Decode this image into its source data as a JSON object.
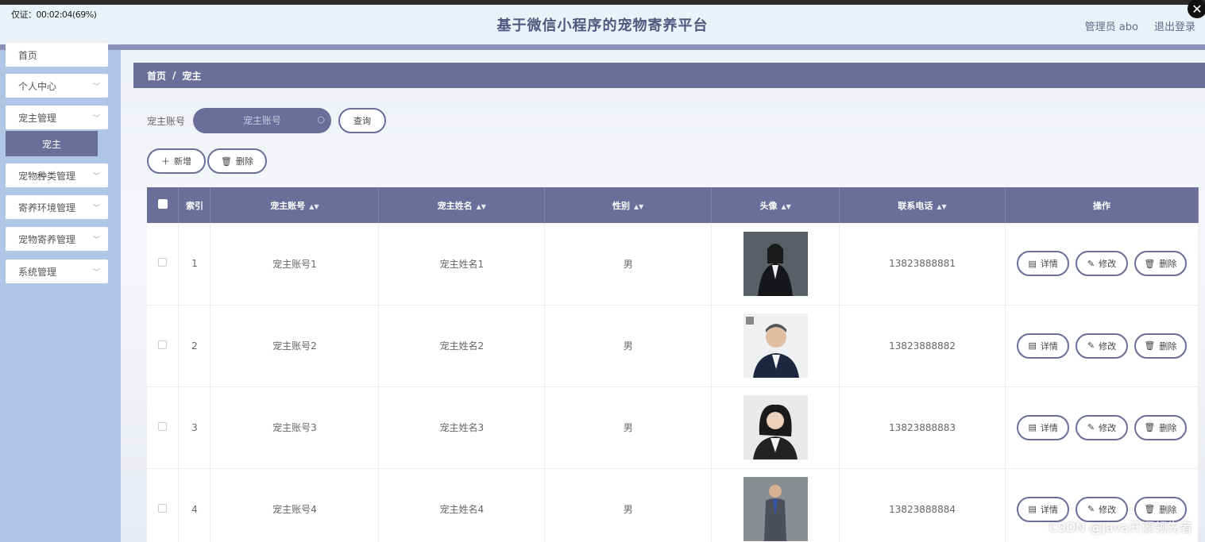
{
  "recording_label": "仅证：00:02:04(69%)",
  "header": {
    "title": "基于微信小程序的宠物寄养平台",
    "user": "管理员 abo",
    "logout": "退出登录"
  },
  "sidebar": {
    "items": [
      {
        "label": "首页"
      },
      {
        "label": "个人中心"
      },
      {
        "label": "宠主管理"
      },
      {
        "label": "宠主"
      },
      {
        "label": "宠物种类管理"
      },
      {
        "label": "寄养环境管理"
      },
      {
        "label": "宠物寄养管理"
      },
      {
        "label": "系统管理"
      }
    ]
  },
  "breadcrumb": {
    "home": "首页",
    "sep": "/",
    "current": "宠主"
  },
  "search": {
    "label": "宠主账号",
    "placeholder": "宠主账号",
    "query_button": "查询"
  },
  "actions": {
    "add": "新增",
    "delete": "删除"
  },
  "table": {
    "headers": {
      "index": "索引",
      "account": "宠主账号",
      "name": "宠主姓名",
      "gender": "性别",
      "avatar": "头像",
      "phone": "联系电话",
      "ops": "操作"
    },
    "rows": [
      {
        "index": "1",
        "account": "宠主账号1",
        "name": "宠主姓名1",
        "gender": "男",
        "phone": "13823888881"
      },
      {
        "index": "2",
        "account": "宠主账号2",
        "name": "宠主姓名2",
        "gender": "男",
        "phone": "13823888882"
      },
      {
        "index": "3",
        "account": "宠主账号3",
        "name": "宠主姓名3",
        "gender": "男",
        "phone": "13823888883"
      },
      {
        "index": "4",
        "account": "宠主账号4",
        "name": "宠主姓名4",
        "gender": "男",
        "phone": "13823888884"
      }
    ],
    "row_actions": {
      "detail": "详情",
      "edit": "修改",
      "delete": "删除"
    }
  },
  "watermark": "CSDN @Java开源领先者",
  "colors": {
    "primary": "#6a6e98",
    "sidebar": "#b0c6e6",
    "header_bg": "#eaf2f9"
  }
}
